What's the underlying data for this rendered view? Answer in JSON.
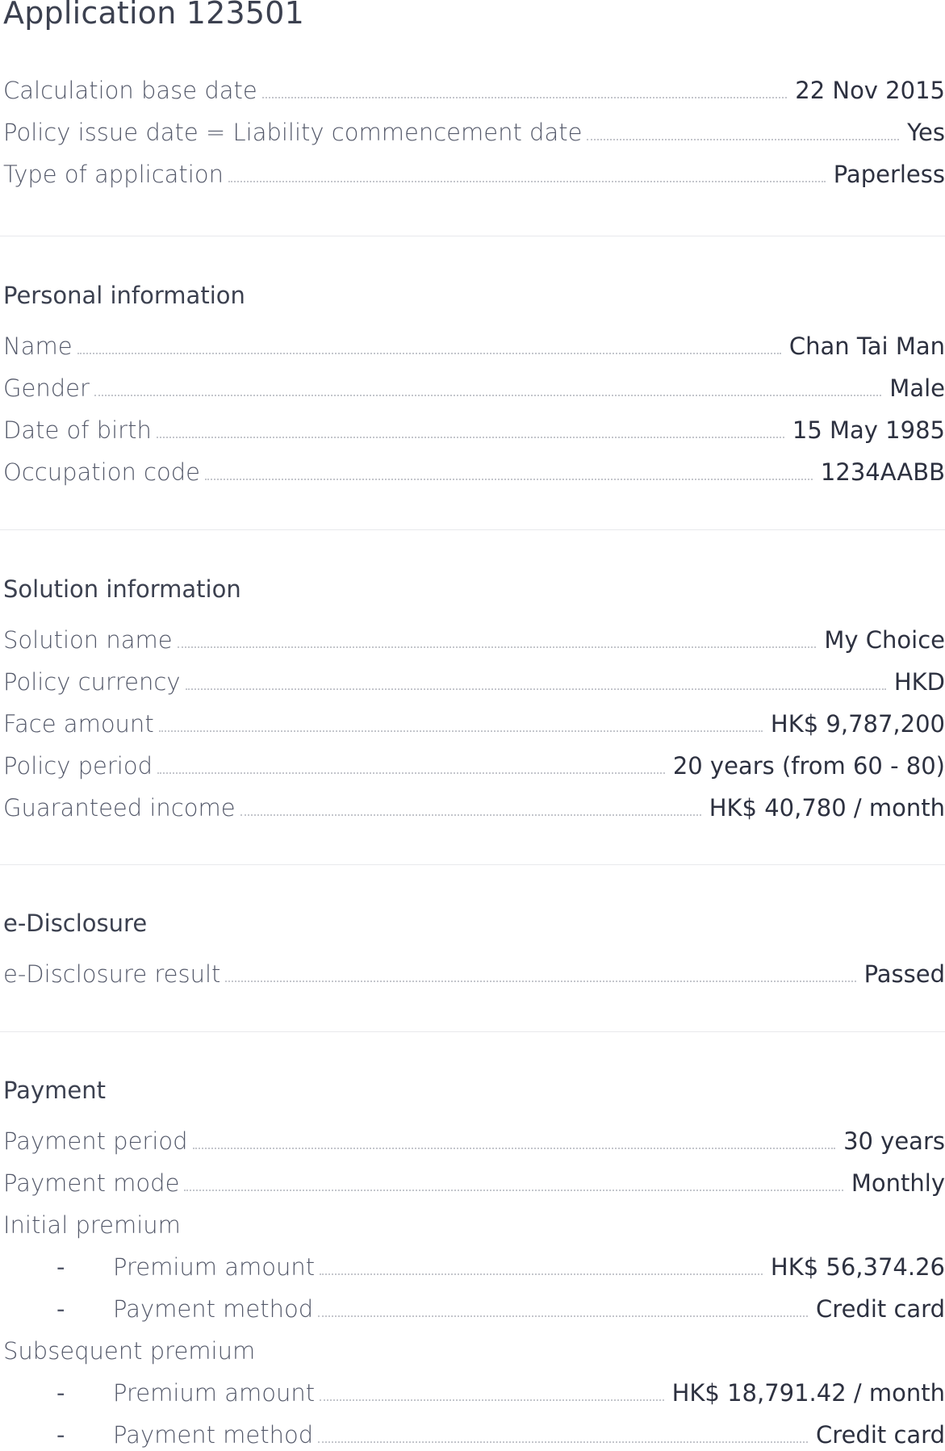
{
  "title": "Application 123501",
  "general": [
    {
      "label": "Calculation base date",
      "value": "22 Nov 2015"
    },
    {
      "label": "Policy issue date = Liability commencement date",
      "value": "Yes"
    },
    {
      "label": "Type of application",
      "value": "Paperless"
    }
  ],
  "personal": {
    "heading": "Personal information",
    "rows": [
      {
        "label": "Name",
        "value": "Chan Tai Man"
      },
      {
        "label": "Gender",
        "value": "Male"
      },
      {
        "label": "Date of birth",
        "value": "15 May 1985"
      },
      {
        "label": "Occupation code",
        "value": "1234AABB"
      }
    ]
  },
  "solution": {
    "heading": "Solution information",
    "rows": [
      {
        "label": "Solution name",
        "value": "My Choice"
      },
      {
        "label": "Policy currency",
        "value": "HKD"
      },
      {
        "label": "Face amount",
        "value": "HK$ 9,787,200"
      },
      {
        "label": "Policy period",
        "value": "20 years (from 60 - 80)"
      },
      {
        "label": "Guaranteed income",
        "value": "HK$ 40,780 / month"
      }
    ]
  },
  "disclosure": {
    "heading": "e-Disclosure",
    "rows": [
      {
        "label": "e-Disclosure result",
        "value": "Passed"
      }
    ]
  },
  "payment": {
    "heading": "Payment",
    "payment_period": {
      "label": "Payment period",
      "value": "30 years"
    },
    "payment_mode": {
      "label": "Payment mode",
      "value": "Monthly"
    },
    "initial": {
      "label": "Initial premium",
      "dash": "-",
      "premium_amount": {
        "label": "Premium amount",
        "value": "HK$ 56,374.26"
      },
      "payment_method": {
        "label": "Payment method",
        "value": "Credit card"
      }
    },
    "subsequent": {
      "label": "Subsequent premium",
      "dash": "-",
      "premium_amount": {
        "label": "Premium amount",
        "value": "HK$ 18,791.42 / month"
      },
      "payment_method": {
        "label": "Payment method",
        "value": "Credit card"
      }
    }
  }
}
